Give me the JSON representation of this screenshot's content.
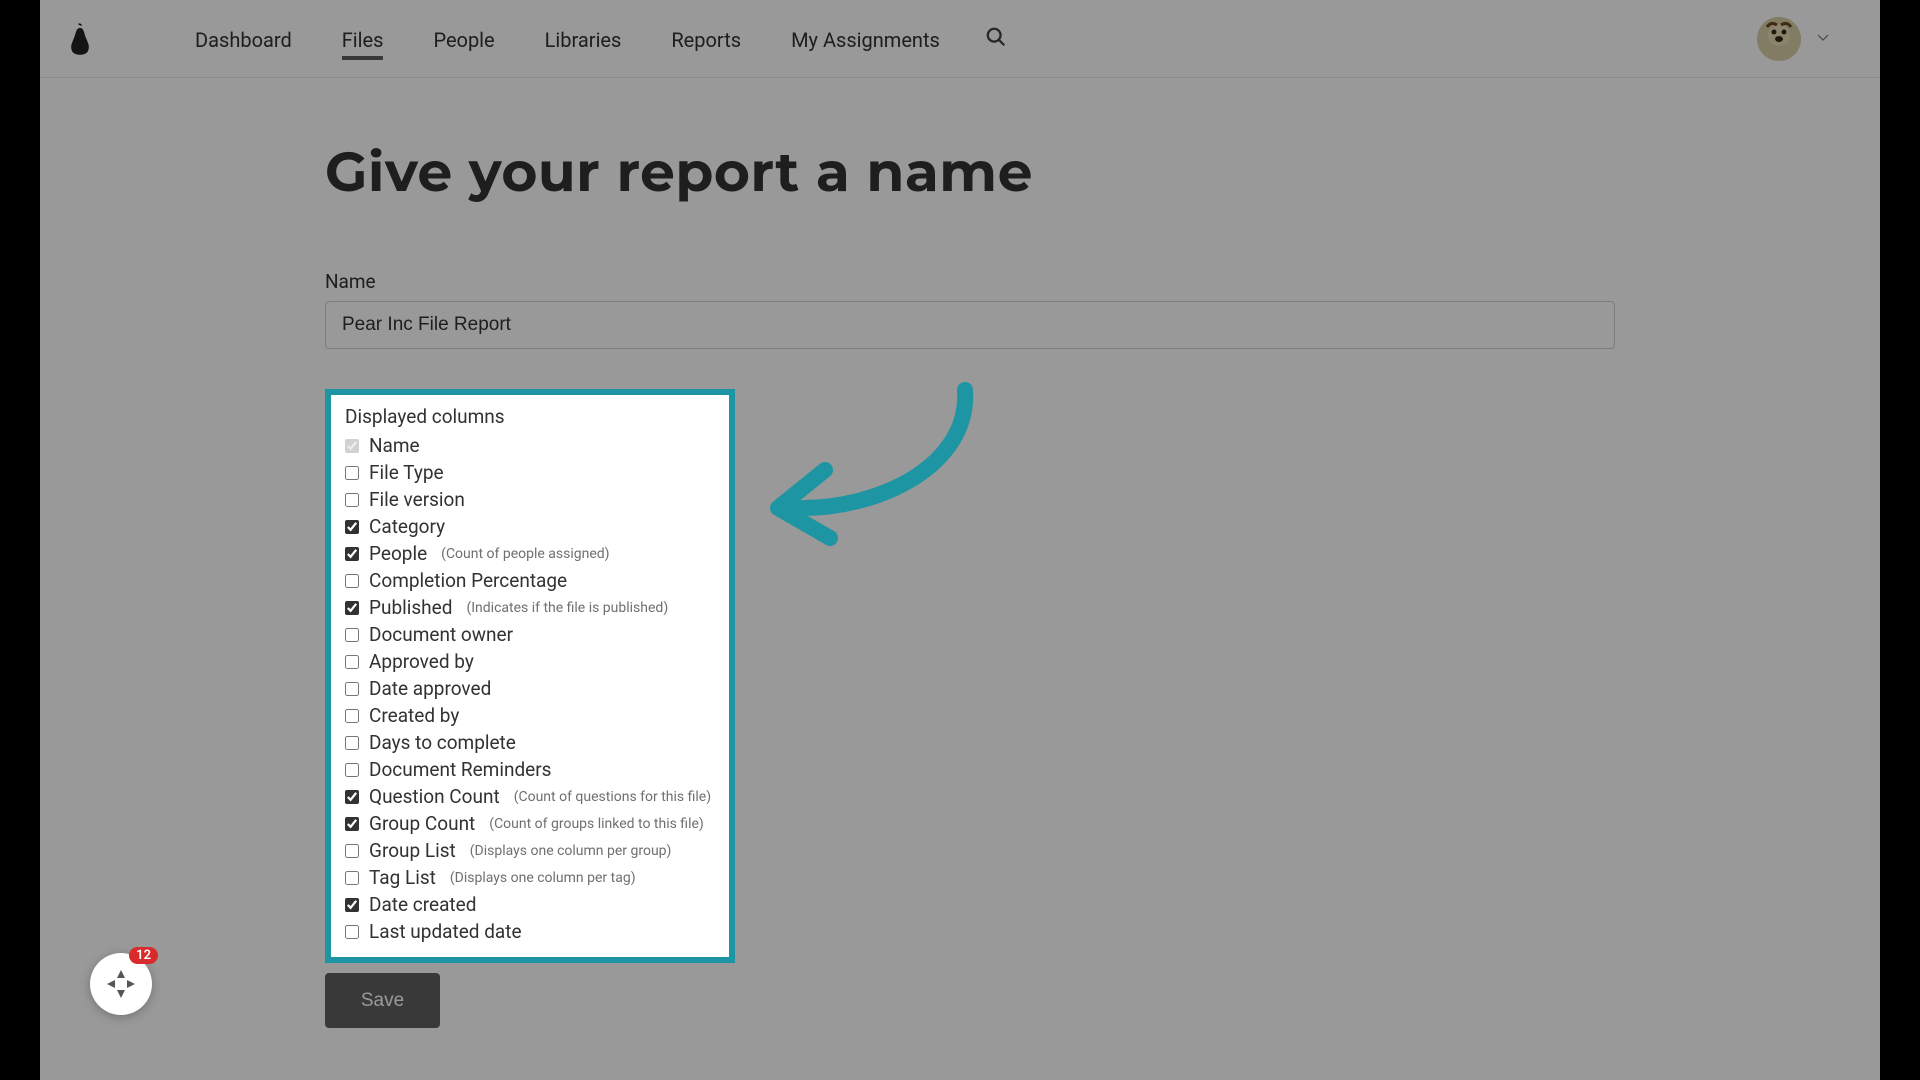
{
  "nav": {
    "items": [
      {
        "label": "Dashboard",
        "active": false
      },
      {
        "label": "Files",
        "active": true
      },
      {
        "label": "People",
        "active": false
      },
      {
        "label": "Libraries",
        "active": false
      },
      {
        "label": "Reports",
        "active": false
      },
      {
        "label": "My Assignments",
        "active": false
      }
    ]
  },
  "page": {
    "title": "Give your report a name",
    "name_label": "Name",
    "name_value": "Pear Inc File Report",
    "columns_heading": "Displayed columns",
    "save_label": "Save"
  },
  "columns": [
    {
      "label": "Name",
      "checked": true,
      "disabled": true,
      "hint": ""
    },
    {
      "label": "File Type",
      "checked": false,
      "disabled": false,
      "hint": ""
    },
    {
      "label": "File version",
      "checked": false,
      "disabled": false,
      "hint": ""
    },
    {
      "label": "Category",
      "checked": true,
      "disabled": false,
      "hint": ""
    },
    {
      "label": "People",
      "checked": true,
      "disabled": false,
      "hint": "(Count of people assigned)"
    },
    {
      "label": "Completion Percentage",
      "checked": false,
      "disabled": false,
      "hint": ""
    },
    {
      "label": "Published",
      "checked": true,
      "disabled": false,
      "hint": "(Indicates if the file is published)"
    },
    {
      "label": "Document owner",
      "checked": false,
      "disabled": false,
      "hint": ""
    },
    {
      "label": "Approved by",
      "checked": false,
      "disabled": false,
      "hint": ""
    },
    {
      "label": "Date approved",
      "checked": false,
      "disabled": false,
      "hint": ""
    },
    {
      "label": "Created by",
      "checked": false,
      "disabled": false,
      "hint": ""
    },
    {
      "label": "Days to complete",
      "checked": false,
      "disabled": false,
      "hint": ""
    },
    {
      "label": "Document Reminders",
      "checked": false,
      "disabled": false,
      "hint": ""
    },
    {
      "label": "Question Count",
      "checked": true,
      "disabled": false,
      "hint": "(Count of questions for this file)"
    },
    {
      "label": "Group Count",
      "checked": true,
      "disabled": false,
      "hint": "(Count of groups linked to this file)"
    },
    {
      "label": "Group List",
      "checked": false,
      "disabled": false,
      "hint": "(Displays one column per group)"
    },
    {
      "label": "Tag List",
      "checked": false,
      "disabled": false,
      "hint": "(Displays one column per tag)"
    },
    {
      "label": "Date created",
      "checked": true,
      "disabled": false,
      "hint": ""
    },
    {
      "label": "Last updated date",
      "checked": false,
      "disabled": false,
      "hint": ""
    }
  ],
  "help": {
    "badge": "12"
  },
  "colors": {
    "accent": "#1e95a3"
  }
}
